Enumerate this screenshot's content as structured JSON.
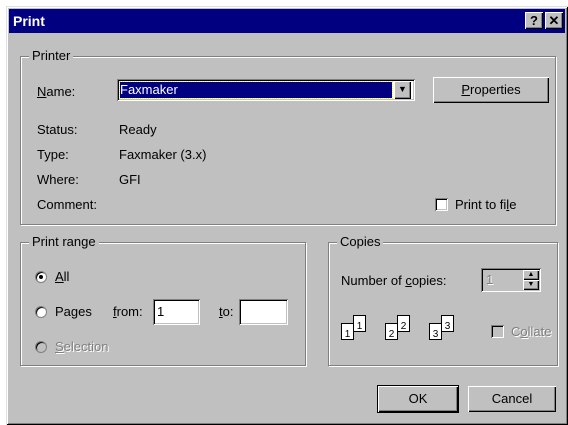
{
  "window": {
    "title": "Print",
    "help_label": "?",
    "close_label": "✕"
  },
  "printer": {
    "legend": "Printer",
    "name_label": "Name:",
    "name_value": "Faxmaker",
    "properties_label": "Properties",
    "status_label": "Status:",
    "status_value": "Ready",
    "type_label": "Type:",
    "type_value": "Faxmaker (3.x)",
    "where_label": "Where:",
    "where_value": "GFI",
    "comment_label": "Comment:",
    "print_to_file_label": "Print to file"
  },
  "print_range": {
    "legend": "Print range",
    "all_label": "All",
    "pages_label": "Pages",
    "from_label": "from:",
    "from_value": "1",
    "to_label": "to:",
    "to_value": "",
    "selection_label": "Selection",
    "selected": "All"
  },
  "copies": {
    "legend": "Copies",
    "number_label": "Number of copies:",
    "number_value": "1",
    "collate_label": "Collate",
    "collate_icon": "collate-pages-icon",
    "page_numbers": [
      "1",
      "1",
      "2",
      "2",
      "3",
      "3"
    ]
  },
  "buttons": {
    "ok_label": "OK",
    "cancel_label": "Cancel"
  },
  "colors": {
    "title_bar": "#000080",
    "face": "#c0c0c0",
    "selection": "#000080"
  }
}
